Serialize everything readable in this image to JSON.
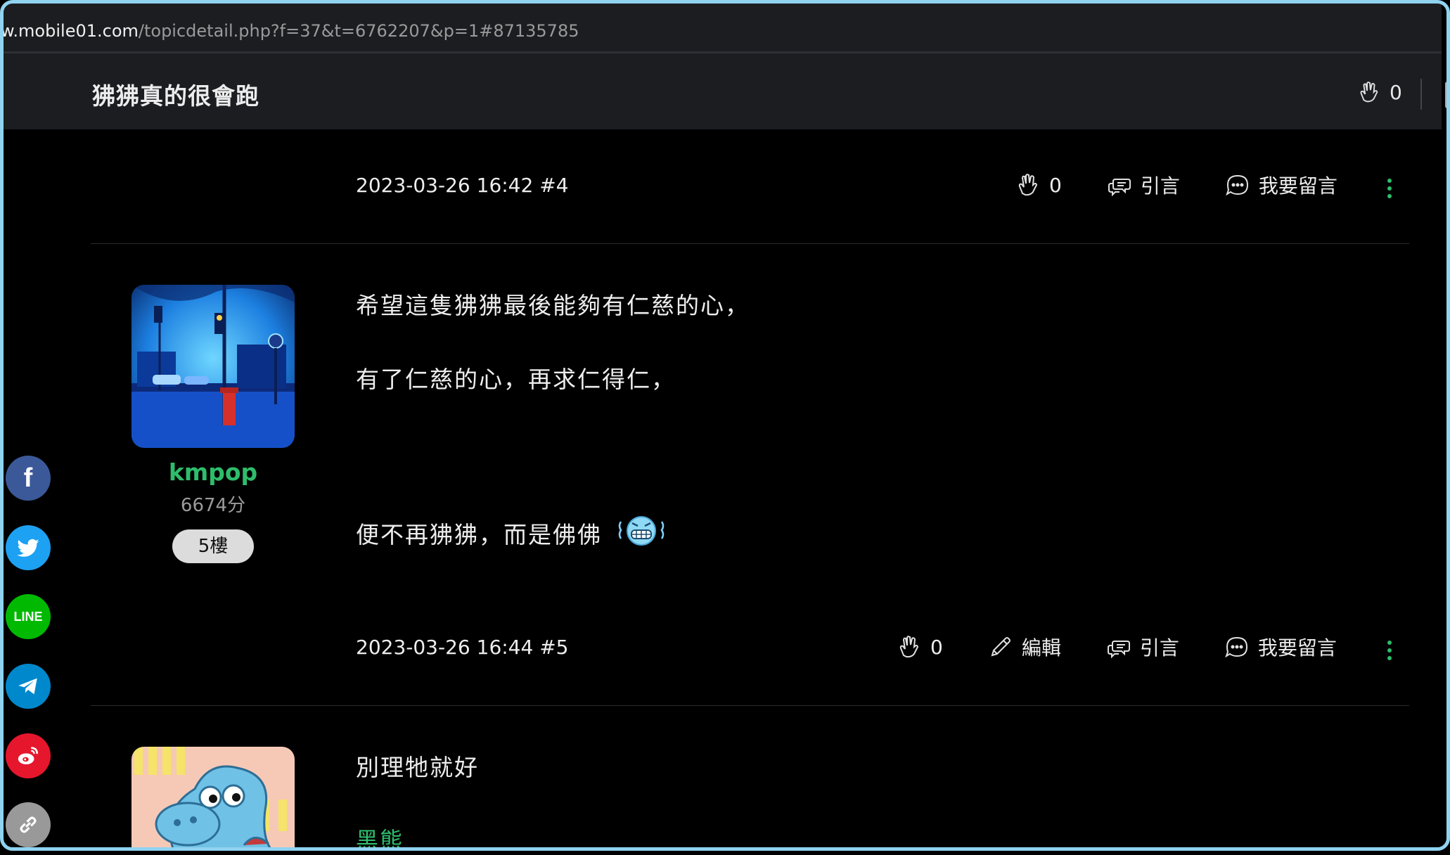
{
  "url": {
    "host": "w.mobile01.com",
    "path": "/topicdetail.php?f=37&t=6762207&p=1#87135785"
  },
  "topic": {
    "title": "狒狒真的很會跑",
    "like_count": "0"
  },
  "posts": [
    {
      "meta": "2023-03-26 16:42 #4",
      "like_count": "0",
      "quote_label": "引言",
      "comment_label": "我要留言"
    },
    {
      "username": "kmpop",
      "score": "6674分",
      "floor": "5樓",
      "lines": [
        "希望這隻狒狒最後能夠有仁慈的心，",
        "有了仁慈的心，再求仁得仁，",
        "便不再狒狒，而是佛佛"
      ],
      "emoji": "grimacing-cold-face",
      "meta": "2023-03-26 16:44 #5",
      "like_count": "0",
      "edit_label": "編輯",
      "quote_label": "引言",
      "comment_label": "我要留言"
    },
    {
      "text": "別理牠就好",
      "signature": "黑熊"
    }
  ],
  "share": [
    {
      "name": "facebook",
      "color": "#3b5998",
      "label": "f"
    },
    {
      "name": "twitter",
      "color": "#1da1f2"
    },
    {
      "name": "line",
      "color": "#00b900",
      "label": "LINE"
    },
    {
      "name": "telegram",
      "color": "#0088cc"
    },
    {
      "name": "weibo",
      "color": "#e6162d"
    },
    {
      "name": "link",
      "color": "#999999"
    }
  ]
}
